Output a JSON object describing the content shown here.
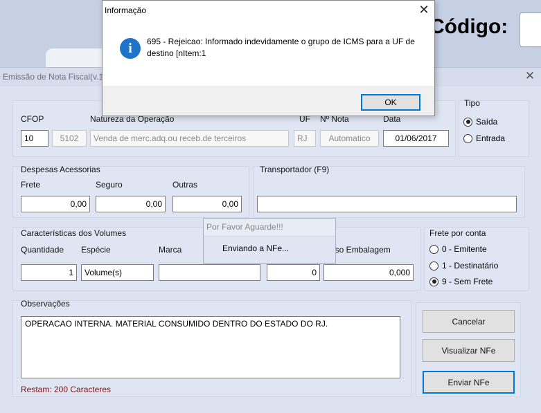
{
  "background": {
    "codigo_label": "Código:"
  },
  "window": {
    "title": "Emissão de Nota Fiscal(v.16",
    "close_glyph": "✕"
  },
  "operation": {
    "cfop_label": "CFOP",
    "natureza_label": "Natureza da Operação",
    "uf_label": "UF",
    "nnota_label": "Nº Nota",
    "data_label": "Data",
    "cfop_code": "10",
    "cfop_number": "5102",
    "natureza_value": "Venda de merc.adq.ou receb.de terceiros",
    "uf_value": "RJ",
    "nnota_value": "Automatico",
    "data_value": "01/06/2017"
  },
  "tipo": {
    "label": "Tipo",
    "options": [
      "Saída",
      "Entrada"
    ],
    "selected": "Saída"
  },
  "despesas": {
    "title": "Despesas Acessorias",
    "frete_label": "Frete",
    "seguro_label": "Seguro",
    "outras_label": "Outras",
    "frete_value": "0,00",
    "seguro_value": "0,00",
    "outras_value": "0,00"
  },
  "transportador": {
    "title": "Transportador (F9)",
    "value": ""
  },
  "volumes": {
    "title": "Características dos Volumes",
    "quantidade_label": "Quantidade",
    "especie_label": "Espécie",
    "marca_label": "Marca",
    "peso_label": "Peso Embalagem",
    "quantidade_value": "1",
    "especie_value": "Volume(s)",
    "marca_value": "",
    "numero_value": "0",
    "peso_value": "0,000"
  },
  "frete_conta": {
    "title": "Frete por conta",
    "options": [
      "0 - Emitente",
      "1 - Destinatário",
      "9 - Sem Frete"
    ],
    "selected": "9 - Sem Frete"
  },
  "observacoes": {
    "title": "Observações",
    "text": "OPERACAO INTERNA. MATERIAL CONSUMIDO DENTRO DO ESTADO DO RJ.",
    "remaining": "Restam: 200 Caracteres"
  },
  "buttons": {
    "cancelar": "Cancelar",
    "visualizar": "Visualizar NFe",
    "enviar": "Enviar NFe"
  },
  "wait_popup": {
    "title": "Por Favor Aguarde!!!",
    "message": "Enviando a NFe..."
  },
  "message_box": {
    "title": "Informação",
    "icon": "info-icon",
    "text": "695 - Rejeicao: Informado indevidamente o grupo de ICMS para a UF de destino [nItem:1",
    "ok_label": "OK",
    "close_glyph": "✕"
  },
  "colors": {
    "accent": "#0078d7",
    "info_icon": "#1e74c9",
    "remaining_text": "#7a1010"
  }
}
